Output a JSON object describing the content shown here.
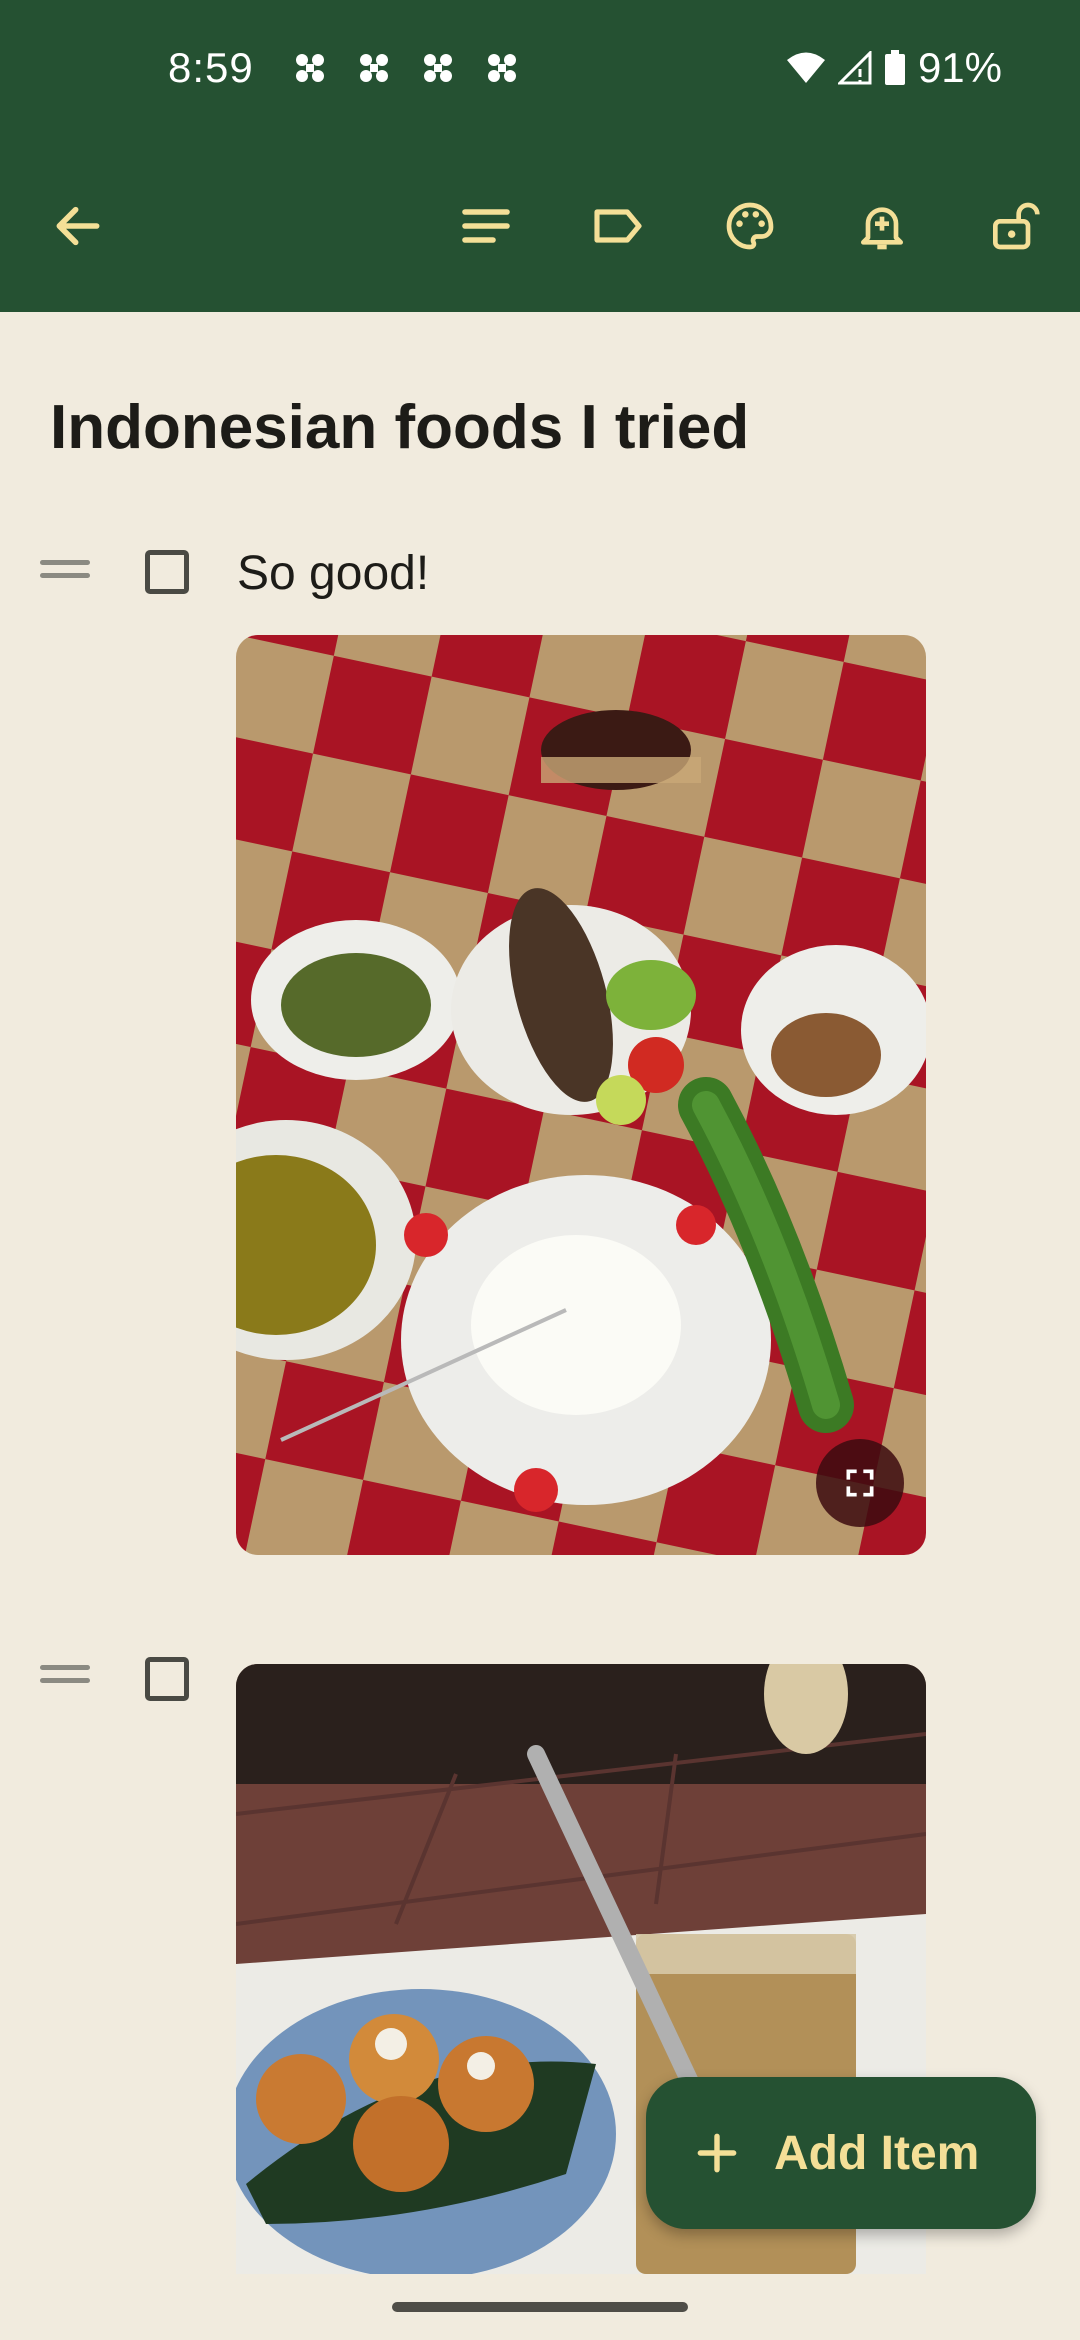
{
  "status_bar": {
    "time": "8:59",
    "battery": "91%",
    "icons": [
      "notification-icon",
      "notification-icon",
      "notification-icon",
      "notification-icon",
      "wifi-icon",
      "signal-icon",
      "battery-icon"
    ]
  },
  "toolbar": {
    "icons": [
      "back-arrow-icon",
      "format-lines-icon",
      "label-tag-icon",
      "palette-icon",
      "reminder-bell-icon",
      "unlock-icon"
    ]
  },
  "note": {
    "title": "Indonesian foods I tried",
    "items": [
      {
        "text": "So good!",
        "checked": false,
        "image": "photo of grilled fish, rice and side dishes on a red checkered table"
      },
      {
        "text": "",
        "checked": false,
        "image": "photo of fried coconut balls on a blue plate and a glass of drink"
      }
    ]
  },
  "fab": {
    "label": "Add Item"
  },
  "colors": {
    "primary": "#255132",
    "accent": "#f4df97",
    "background": "#f1ebde"
  }
}
